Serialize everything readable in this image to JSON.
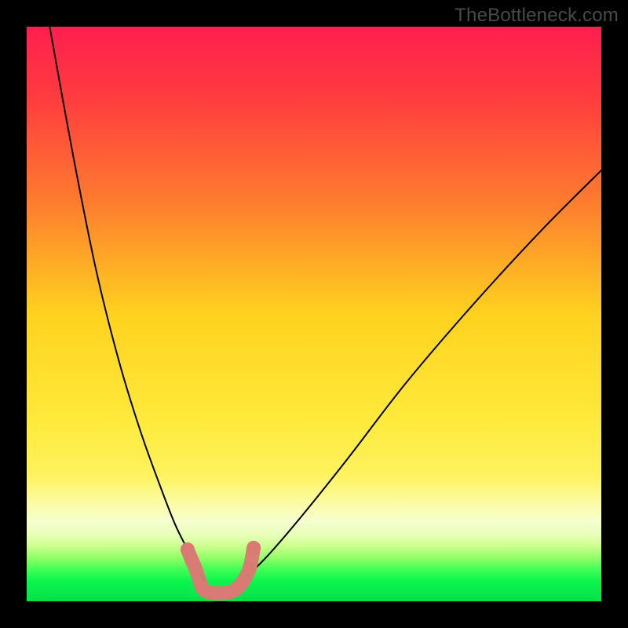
{
  "watermark": "TheBottleneck.com",
  "chart_data": {
    "type": "line",
    "title": "",
    "xlabel": "",
    "ylabel": "",
    "xlim": [
      0,
      100
    ],
    "ylim": [
      0,
      100
    ],
    "grid": false,
    "legend": false,
    "description": "Bottleneck-style V-curve over a vertical red→yellow→green heat gradient. Two black curves descend from the top edges toward a minimum near x≈33, where a short salmon segment of markers sits in the green band near y≈0. A thin bright-green horizontal strip runs along the bottom edge; a pale-yellow band sits just above it.",
    "gradient_stops": [
      {
        "offset": 0.0,
        "color": "#ff1f4f"
      },
      {
        "offset": 0.12,
        "color": "#ff3b3f"
      },
      {
        "offset": 0.3,
        "color": "#fd7a2f"
      },
      {
        "offset": 0.5,
        "color": "#ffd21f"
      },
      {
        "offset": 0.68,
        "color": "#ffe93a"
      },
      {
        "offset": 0.78,
        "color": "#fef35e"
      },
      {
        "offset": 0.83,
        "color": "#fbfca6"
      },
      {
        "offset": 0.86,
        "color": "#f6fecf"
      },
      {
        "offset": 0.885,
        "color": "#e8ffb8"
      },
      {
        "offset": 0.905,
        "color": "#c9ff8c"
      },
      {
        "offset": 0.925,
        "color": "#8fff66"
      },
      {
        "offset": 0.945,
        "color": "#3fff55"
      },
      {
        "offset": 0.965,
        "color": "#0cf54e"
      },
      {
        "offset": 1.0,
        "color": "#06e048"
      }
    ],
    "series": [
      {
        "name": "left-arm",
        "x": [
          4,
          8,
          12,
          16,
          20,
          24,
          26,
          28,
          29.5,
          31,
          32.5
        ],
        "y": [
          100,
          78,
          58,
          42,
          29,
          18,
          13,
          9,
          6,
          3.5,
          1.5
        ]
      },
      {
        "name": "right-arm",
        "x": [
          36,
          38,
          42,
          48,
          56,
          66,
          78,
          90,
          100
        ],
        "y": [
          2,
          4,
          8,
          15,
          25,
          38,
          52,
          65,
          75
        ]
      }
    ],
    "marker_points": {
      "name": "bottom-markers",
      "color": "#d97a74",
      "radius_px": 9,
      "points": [
        {
          "x": 28.0,
          "y": 9.0
        },
        {
          "x": 28.7,
          "y": 7.2
        },
        {
          "x": 29.4,
          "y": 5.6
        },
        {
          "x": 30.5,
          "y": 2.4
        },
        {
          "x": 31.6,
          "y": 1.6
        },
        {
          "x": 32.8,
          "y": 1.4
        },
        {
          "x": 34.0,
          "y": 1.4
        },
        {
          "x": 35.3,
          "y": 1.6
        },
        {
          "x": 36.5,
          "y": 2.2
        },
        {
          "x": 37.6,
          "y": 3.4
        },
        {
          "x": 38.8,
          "y": 5.8
        },
        {
          "x": 39.5,
          "y": 9.3
        }
      ]
    }
  }
}
